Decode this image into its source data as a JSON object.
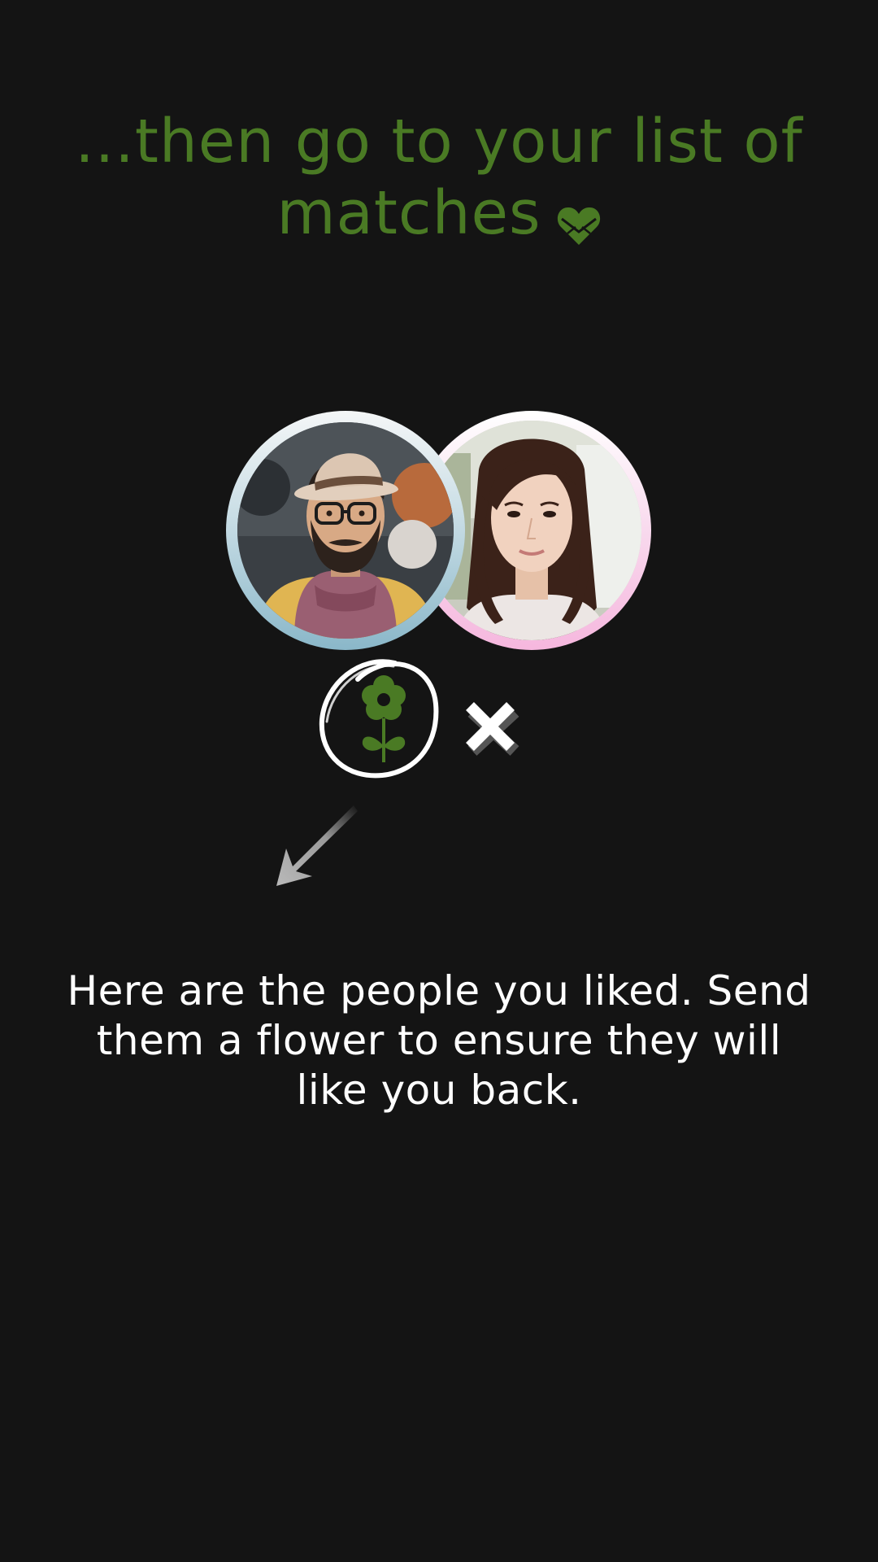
{
  "headline": {
    "text": "...then go to your list of matches",
    "icon": "heart-envelope-icon"
  },
  "colors": {
    "background": "#141414",
    "accent_green": "#4a7a24",
    "man_ring": "#8ab7c9",
    "woman_ring": "#f6b7de",
    "body_text": "#ffffff"
  },
  "illustration": {
    "avatars": [
      {
        "name": "man-avatar",
        "icon": "profile-photo-man"
      },
      {
        "name": "woman-avatar",
        "icon": "profile-photo-woman"
      }
    ],
    "actions": [
      {
        "name": "send-flower",
        "icon": "flower-icon"
      },
      {
        "name": "dismiss",
        "icon": "close-icon"
      }
    ],
    "pointer": "arrow-down-left-icon"
  },
  "body": {
    "text": "Here are the people you liked. Send them a flower to ensure they will like you back."
  }
}
